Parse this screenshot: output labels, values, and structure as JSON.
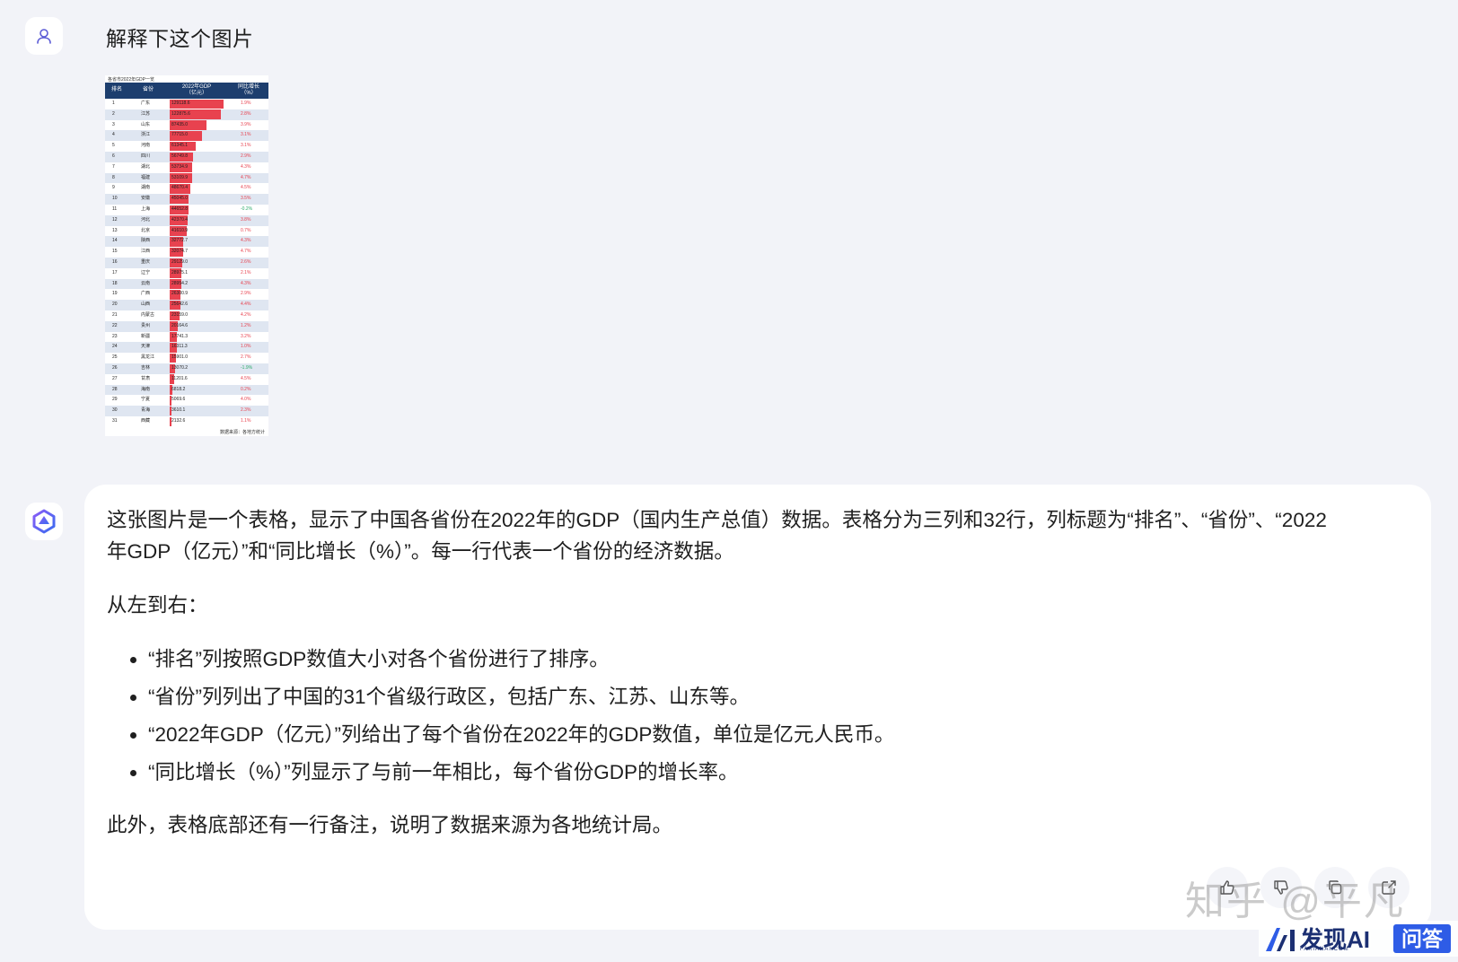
{
  "user": {
    "message": "解释下这个图片",
    "avatar_icon": "user-icon"
  },
  "image": {
    "title": "各省市2022年GDP一览",
    "headers": {
      "rank": "排名",
      "province": "省份",
      "gdp": "2022年GDP（亿元）",
      "growth": "同比增长（%）"
    },
    "footer": "数据来源：各地方统计",
    "bar_color": "#e8424f",
    "header_color": "#1d3e6e",
    "rows": [
      {
        "rank": "1",
        "province": "广东",
        "gdp": 129118.6,
        "growth": "1.9%"
      },
      {
        "rank": "2",
        "province": "江苏",
        "gdp": 122875.6,
        "growth": "2.8%"
      },
      {
        "rank": "3",
        "province": "山东",
        "gdp": 87435.0,
        "growth": "3.9%"
      },
      {
        "rank": "4",
        "province": "浙江",
        "gdp": 77715.0,
        "growth": "3.1%"
      },
      {
        "rank": "5",
        "province": "河南",
        "gdp": 61345.1,
        "growth": "3.1%"
      },
      {
        "rank": "6",
        "province": "四川",
        "gdp": 56749.8,
        "growth": "2.9%"
      },
      {
        "rank": "7",
        "province": "湖北",
        "gdp": 53734.9,
        "growth": "4.3%"
      },
      {
        "rank": "8",
        "province": "福建",
        "gdp": 53109.9,
        "growth": "4.7%"
      },
      {
        "rank": "9",
        "province": "湖南",
        "gdp": 48670.4,
        "growth": "4.5%"
      },
      {
        "rank": "10",
        "province": "安徽",
        "gdp": 45045.0,
        "growth": "3.5%"
      },
      {
        "rank": "11",
        "province": "上海",
        "gdp": 44652.8,
        "growth": "-0.2%"
      },
      {
        "rank": "12",
        "province": "河北",
        "gdp": 42370.4,
        "growth": "3.8%"
      },
      {
        "rank": "13",
        "province": "北京",
        "gdp": 41610.9,
        "growth": "0.7%"
      },
      {
        "rank": "14",
        "province": "陕西",
        "gdp": 32772.7,
        "growth": "4.3%"
      },
      {
        "rank": "15",
        "province": "江西",
        "gdp": 32074.7,
        "growth": "4.7%"
      },
      {
        "rank": "16",
        "province": "重庆",
        "gdp": 29129.0,
        "growth": "2.6%"
      },
      {
        "rank": "17",
        "province": "辽宁",
        "gdp": 28975.1,
        "growth": "2.1%"
      },
      {
        "rank": "18",
        "province": "云南",
        "gdp": 28954.2,
        "growth": "4.3%"
      },
      {
        "rank": "19",
        "province": "广西",
        "gdp": 26300.9,
        "growth": "2.9%"
      },
      {
        "rank": "20",
        "province": "山西",
        "gdp": 25642.6,
        "growth": "4.4%"
      },
      {
        "rank": "21",
        "province": "内蒙古",
        "gdp": 23159.0,
        "growth": "4.2%"
      },
      {
        "rank": "22",
        "province": "贵州",
        "gdp": 20164.6,
        "growth": "1.2%"
      },
      {
        "rank": "23",
        "province": "新疆",
        "gdp": 17741.3,
        "growth": "3.2%"
      },
      {
        "rank": "24",
        "province": "天津",
        "gdp": 16311.3,
        "growth": "1.0%"
      },
      {
        "rank": "25",
        "province": "黑龙江",
        "gdp": 15901.0,
        "growth": "2.7%"
      },
      {
        "rank": "26",
        "province": "吉林",
        "gdp": 13070.2,
        "growth": "-1.9%"
      },
      {
        "rank": "27",
        "province": "甘肃",
        "gdp": 11201.6,
        "growth": "4.5%"
      },
      {
        "rank": "28",
        "province": "海南",
        "gdp": 6818.2,
        "growth": "0.2%"
      },
      {
        "rank": "29",
        "province": "宁夏",
        "gdp": 5069.6,
        "growth": "4.0%"
      },
      {
        "rank": "30",
        "province": "青海",
        "gdp": 3610.1,
        "growth": "2.3%"
      },
      {
        "rank": "31",
        "province": "西藏",
        "gdp": 2132.6,
        "growth": "1.1%"
      }
    ]
  },
  "assistant": {
    "avatar_icon": "bot-logo-icon",
    "paragraph1": "这张图片是一个表格，显示了中国各省份在2022年的GDP（国内生产总值）数据。表格分为三列和32行，列标题为“排名”、“省份”、“2022年GDP（亿元）”和“同比增长（%）”。每一行代表一个省份的经济数据。",
    "paragraph2": "从左到右：",
    "bullets": [
      "“排名”列按照GDP数值大小对各个省份进行了排序。",
      "“省份”列列出了中国的31个省级行政区，包括广东、江苏、山东等。",
      "“2022年GDP（亿元）”列给出了每个省份在2022年的GDP数值，单位是亿元人民币。",
      "“同比增长（%）”列显示了与前一年相比，每个省份GDP的增长率。"
    ],
    "paragraph3": "此外，表格底部还有一行备注，说明了数据来源为各地统计局。",
    "actions": [
      "thumb-up-icon",
      "thumb-down-icon",
      "copy-icon",
      "share-icon"
    ]
  },
  "watermark": "知乎 @平凡",
  "brand": {
    "name": "发现AI",
    "sub": "FAXIANAI.COM",
    "tag": "问答"
  },
  "colors": {
    "positive": "#e8424f",
    "negative": "#2eaa6b",
    "accent": "#6b5cf5"
  }
}
